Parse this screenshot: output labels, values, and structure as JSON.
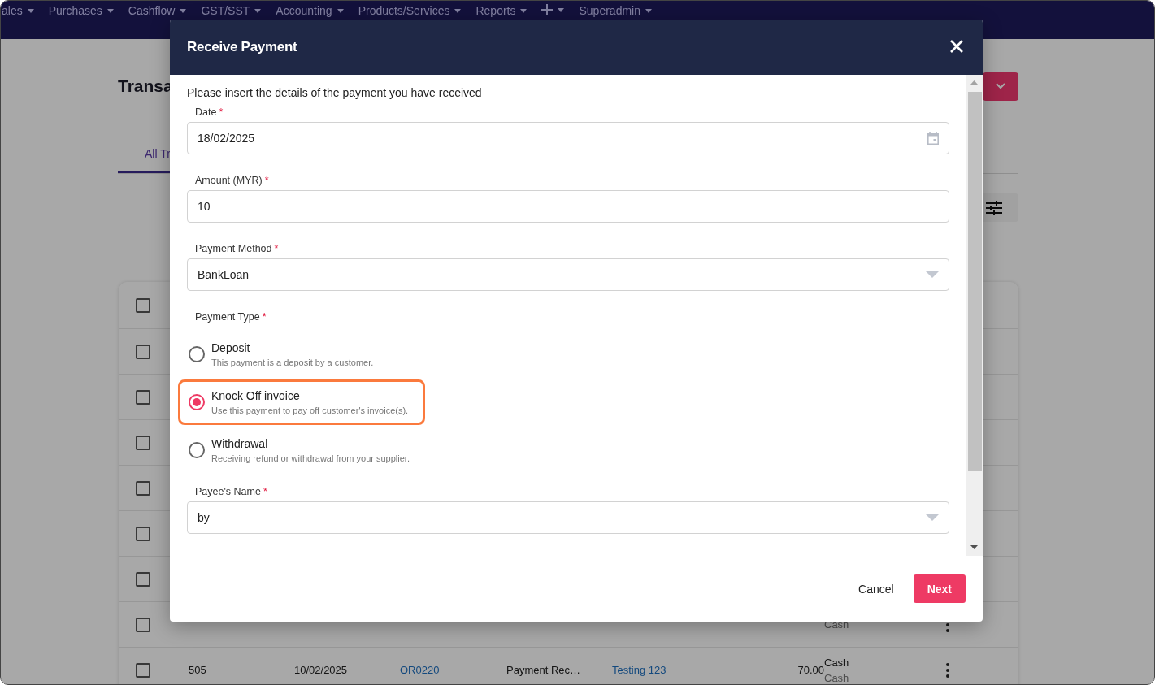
{
  "nav": {
    "items": [
      {
        "kind": "menu",
        "label": "ales"
      },
      {
        "kind": "menu",
        "label": "Purchases"
      },
      {
        "kind": "menu",
        "label": "Cashflow"
      },
      {
        "kind": "menu",
        "label": "GST/SST"
      },
      {
        "kind": "menu",
        "label": "Accounting"
      },
      {
        "kind": "menu",
        "label": "Products/Services"
      },
      {
        "kind": "menu",
        "label": "Reports"
      },
      {
        "kind": "add"
      },
      {
        "kind": "menu",
        "label": "Superadmin"
      }
    ]
  },
  "page": {
    "title": "Transa",
    "tab": {
      "label": "All Tr",
      "selected": true
    }
  },
  "table": {
    "header_checked": false,
    "rows": [
      {
        "checked": false
      },
      {
        "checked": false
      },
      {
        "checked": false
      },
      {
        "checked": false
      },
      {
        "checked": false
      },
      {
        "checked": false
      },
      {
        "checked": false,
        "payment_sub": "Cash"
      },
      {
        "checked": false,
        "cells": [
          "505",
          "10/02/2025",
          "OR0220",
          "Payment Rec…",
          "Testing 123",
          "70.00"
        ],
        "payment": "Cash",
        "payment_sub": "Cash"
      }
    ]
  },
  "dialog": {
    "title": "Receive Payment",
    "intro": "Please insert the details of the payment you have received",
    "fields": [
      {
        "kind": "date",
        "label": "Date",
        "marker": "*",
        "value": "18/02/2025"
      },
      {
        "kind": "text",
        "label": "Amount (MYR)",
        "marker": "*",
        "value": "10"
      },
      {
        "kind": "select",
        "label": "Payment Method",
        "marker": "*",
        "value": "BankLoan"
      },
      {
        "kind": "radio",
        "label": "Payment Type",
        "marker": "*",
        "options": [
          {
            "label": "Deposit",
            "hint": "This payment is a deposit by a customer.",
            "selected": false,
            "highlighted": false
          },
          {
            "label": "Knock Off invoice",
            "hint": "Use this payment to pay off customer's invoice(s).",
            "selected": true,
            "highlighted": true
          },
          {
            "label": "Withdrawal",
            "hint": "Receiving refund or withdrawal from your supplier.",
            "selected": false,
            "highlighted": false
          }
        ]
      },
      {
        "kind": "select",
        "label": "Payee's Name",
        "marker": "*",
        "value": "by"
      }
    ],
    "buttons": [
      {
        "kind": "text",
        "label": "Cancel"
      },
      {
        "kind": "primary",
        "label": "Next"
      }
    ]
  }
}
